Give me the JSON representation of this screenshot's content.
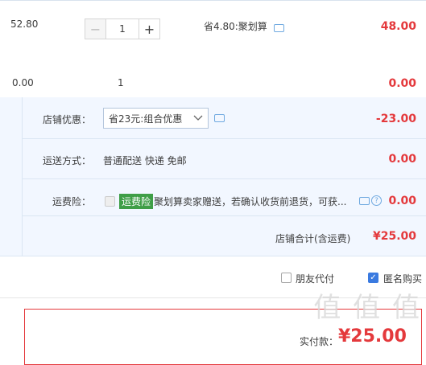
{
  "item": {
    "unit_price": "52.80",
    "quantity": "1",
    "discount_note": "省4.80:聚划算",
    "subtotal": "48.00",
    "minus": "−",
    "plus": "+"
  },
  "row2": {
    "price": "0.00",
    "quantity": "1",
    "subtotal": "0.00"
  },
  "shop_promo": {
    "label": "店铺优惠：",
    "selected": "省23元:组合优惠",
    "amount": "-23.00"
  },
  "shipping": {
    "label": "运送方式：",
    "value": "普通配送 快递 免邮",
    "amount": "0.00"
  },
  "insurance": {
    "label": "运费险：",
    "badge": "运费险",
    "text": "聚划算卖家赠送，若确认收货前退货，可获...",
    "amount": "0.00"
  },
  "shop_total": {
    "label": "店铺合计(含运费)",
    "amount": "¥25.00"
  },
  "options": {
    "friend_pay": "朋友代付",
    "anonymous": "匿名购买"
  },
  "pay": {
    "label": "实付款：",
    "amount": "¥25.00"
  },
  "watermark": "值 值 值"
}
